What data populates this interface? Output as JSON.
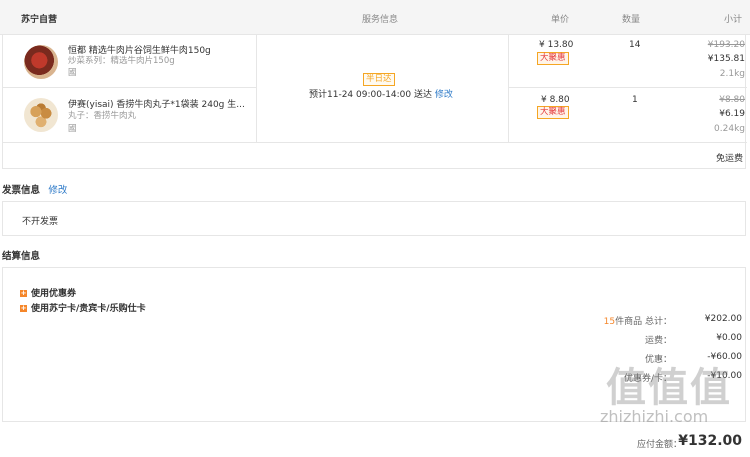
{
  "header": {
    "store": "苏宁自营",
    "service": "服务信息",
    "price": "单价",
    "qty": "数量",
    "subtotal": "小计"
  },
  "items": [
    {
      "name": "恒都 精选牛肉片谷饲生鲜牛肉150g",
      "sub1": "炒菜系列：精选牛肉片150g",
      "sub2": "國",
      "unit_price": "¥ 13.80",
      "tag": "大聚惠",
      "qty": "14",
      "orig": "¥193.20",
      "final": "¥135.81",
      "weight": "2.1kg",
      "icon": "beef-slices-thumbnail"
    },
    {
      "name": "伊赛(yisai) 香捞牛肉丸子*1袋装 240g 生...",
      "sub1": "丸子：香捞牛肉丸",
      "sub2": "國",
      "unit_price": "¥ 8.80",
      "tag": "大聚惠",
      "qty": "1",
      "orig": "¥8.80",
      "final": "¥6.19",
      "weight": "0.24kg",
      "icon": "beef-balls-thumbnail"
    }
  ],
  "service": {
    "badge": "半日达",
    "eta": "预计11-24 09:00-14:00 送达",
    "modify": "修改"
  },
  "shipping": "免运费",
  "invoice": {
    "title": "发票信息",
    "modify": "修改",
    "value": "不开发票"
  },
  "settlement": {
    "title": "结算信息",
    "coupon": "使用优惠券",
    "card": "使用苏宁卡/贵宾卡/乐购仕卡",
    "count": "15",
    "count_label": "件商品 总计：",
    "total_goods": "¥202.00",
    "freight_label": "运费：",
    "freight": "¥0.00",
    "discount_label": "优惠：",
    "discount": "-¥60.00",
    "coupon_label": "优惠券/卡：",
    "coupon_val": "-¥10.00",
    "pay_label": "应付金额：",
    "pay": "¥132.00"
  },
  "watermark": "zhizhizhi.com",
  "colors": {
    "accent": "#f5862a",
    "price_red": "#e4393c",
    "link": "#2f7bc8"
  }
}
